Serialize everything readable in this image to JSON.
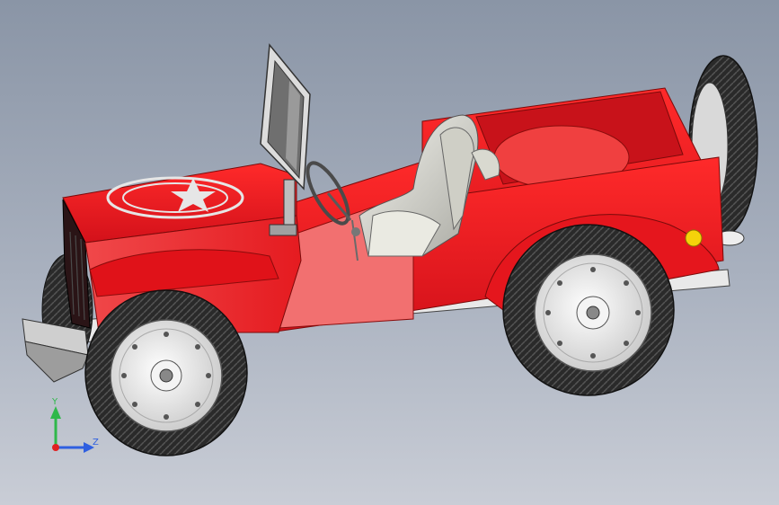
{
  "view": {
    "model_name": "Jeep toy car",
    "background_top": "#8a95a6",
    "background_bottom": "#c9cdd6"
  },
  "triad": {
    "y_label": "Y",
    "z_label": "Z",
    "y_color": "#2fb84a",
    "z_color": "#2f5fe0",
    "x_color": "#e02020"
  },
  "colors": {
    "body_red": "#e8151b",
    "body_dark": "#b50d12",
    "tire": "#262626",
    "rim": "#e6e6e6",
    "chrome": "#d8d8d8",
    "seat": "#e4e4dc",
    "light": "#f5d20a"
  },
  "icons": [
    "star-emblem-icon",
    "steering-wheel-icon"
  ]
}
